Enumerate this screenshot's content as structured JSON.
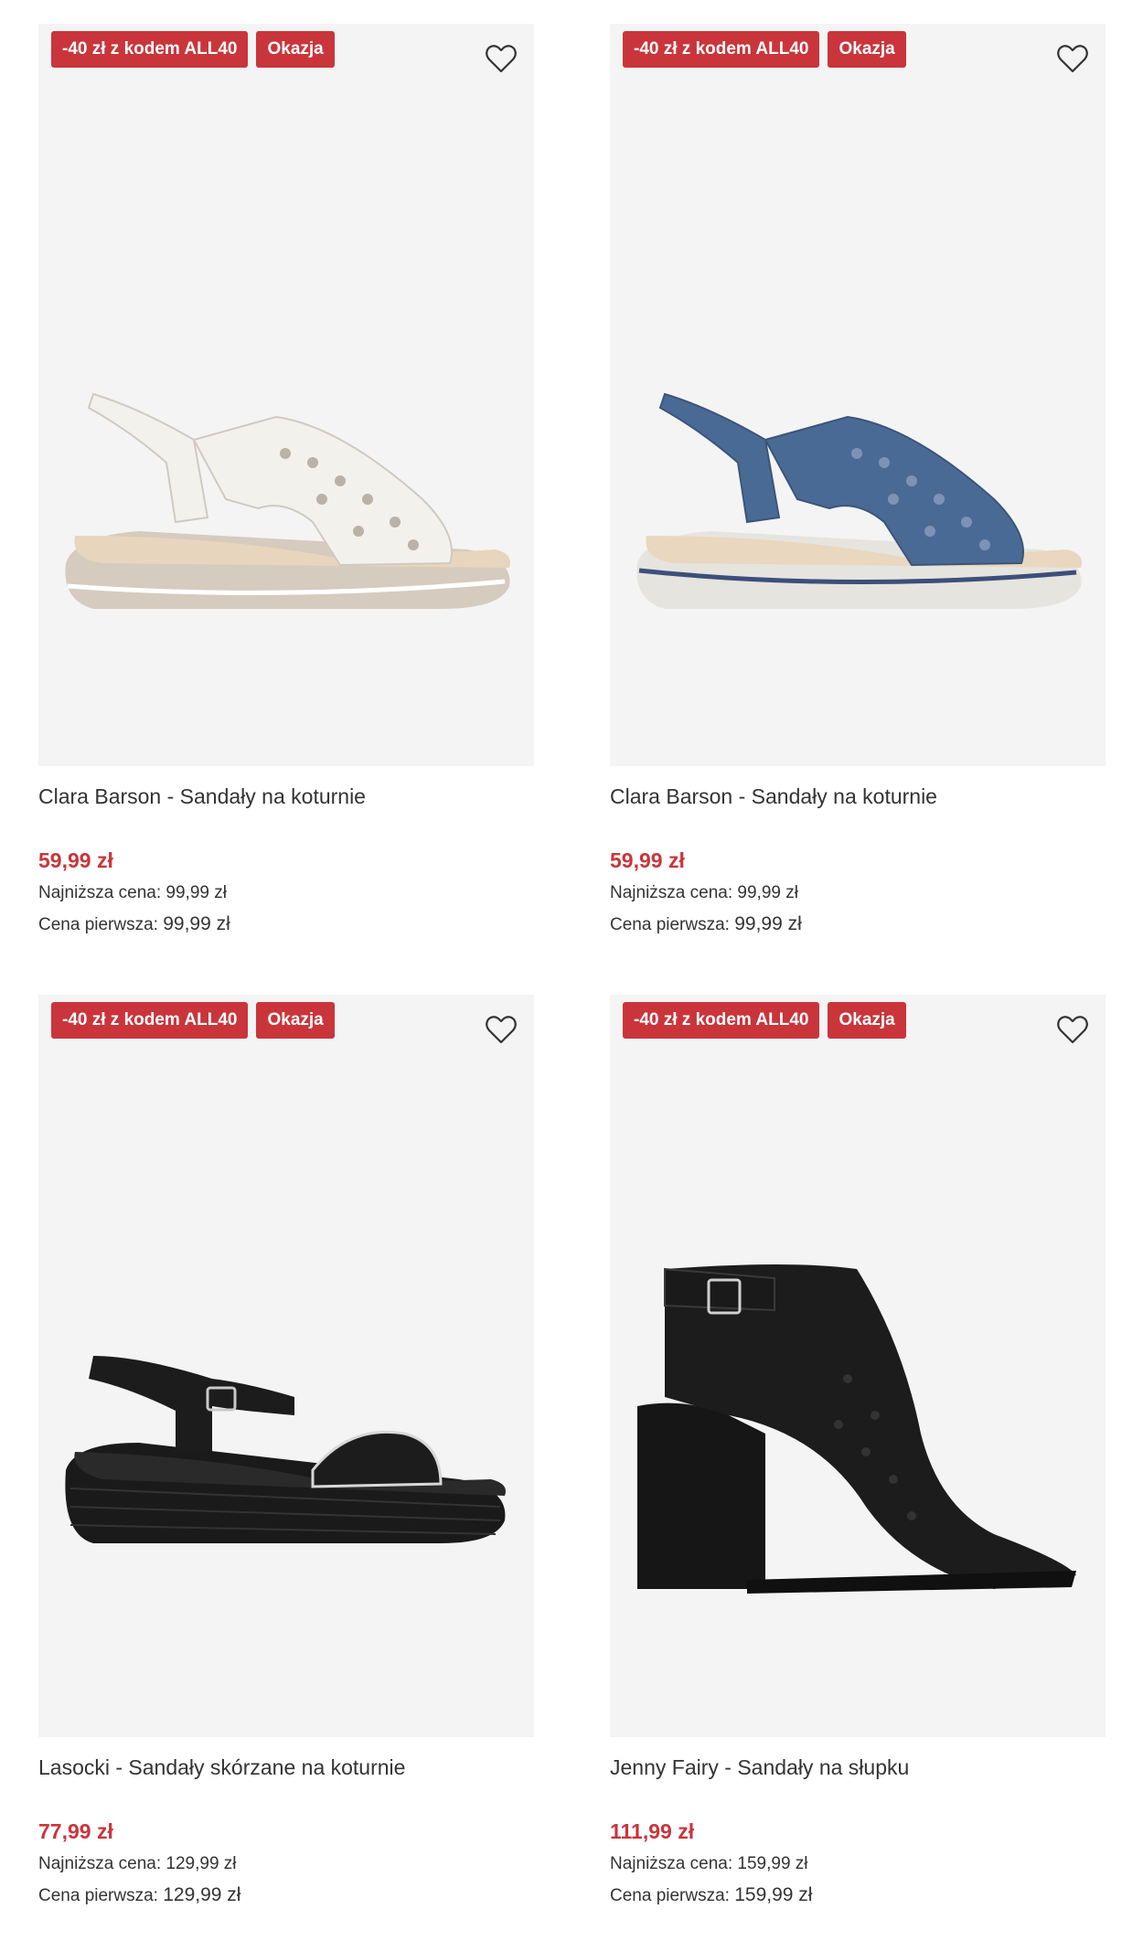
{
  "products": [
    {
      "badges": [
        "-40 zł z kodem ALL40",
        "Okazja"
      ],
      "title": "Clara Barson - Sandały na koturnie",
      "price": "59,99 zł",
      "lowest_label": "Najniższa cena:",
      "lowest_value": "99,99 zł",
      "first_label": "Cena pierwsza:",
      "first_value": "99,99 zł",
      "shoe_color": "#f3f1ec",
      "sole_color": "#d8cfc4"
    },
    {
      "badges": [
        "-40 zł z kodem ALL40",
        "Okazja"
      ],
      "title": "Clara Barson - Sandały na koturnie",
      "price": "59,99 zł",
      "lowest_label": "Najniższa cena:",
      "lowest_value": "99,99 zł",
      "first_label": "Cena pierwsza:",
      "first_value": "99,99 zł",
      "shoe_color": "#4a6a96",
      "sole_color": "#e6e4de"
    },
    {
      "badges": [
        "-40 zł z kodem ALL40",
        "Okazja"
      ],
      "title": "Lasocki - Sandały skórzane na koturnie",
      "price": "77,99 zł",
      "lowest_label": "Najniższa cena:",
      "lowest_value": "129,99 zł",
      "first_label": "Cena pierwsza:",
      "first_value": "129,99 zł",
      "shoe_color": "#1c1c1c",
      "sole_color": "#111111"
    },
    {
      "badges": [
        "-40 zł z kodem ALL40",
        "Okazja"
      ],
      "title": "Jenny Fairy - Sandały na słupku",
      "price": "111,99 zł",
      "lowest_label": "Najniższa cena:",
      "lowest_value": "159,99 zł",
      "first_label": "Cena pierwsza:",
      "first_value": "159,99 zł",
      "shoe_color": "#1a1a1a",
      "sole_color": "#111111"
    }
  ],
  "icons": {
    "favorite": "heart-outline-icon"
  },
  "colors": {
    "accent": "#c9353b",
    "image_bg": "#f4f4f4"
  }
}
